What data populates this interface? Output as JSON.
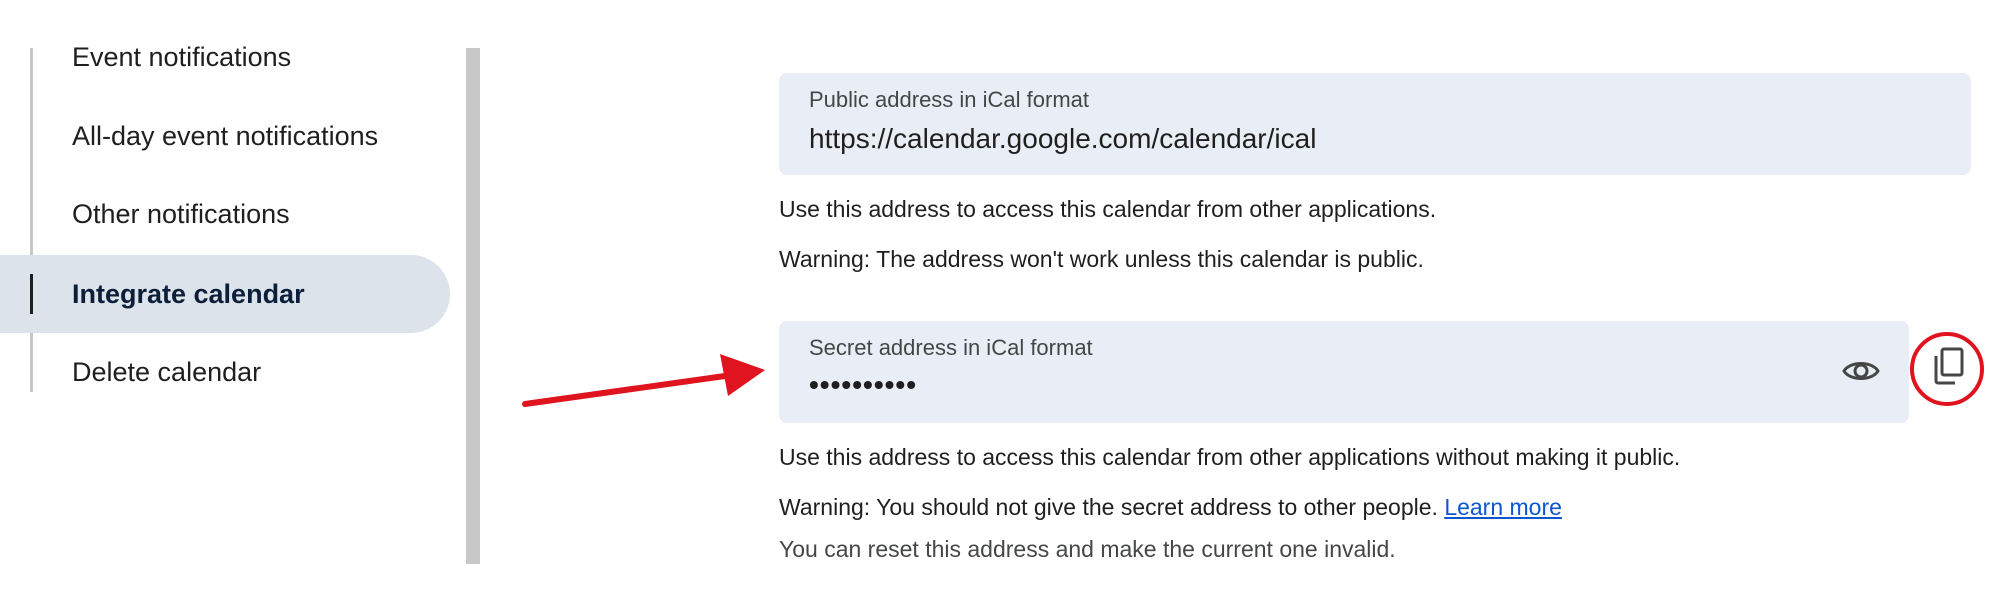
{
  "sidebar": {
    "items": [
      {
        "label": "Event notifications"
      },
      {
        "label": "All-day event notifications"
      },
      {
        "label": "Other notifications"
      },
      {
        "label": "Integrate calendar"
      },
      {
        "label": "Delete calendar"
      }
    ],
    "active_item": "Integrate calendar"
  },
  "public_address": {
    "label": "Public address in iCal format",
    "value": "https://calendar.google.com/calendar/ical",
    "help": "Use this address to access this calendar from other applications.",
    "warning": "Warning: The address won't work unless this calendar is public."
  },
  "secret_address": {
    "label": "Secret address in iCal format",
    "value": "••••••••••",
    "show_icon": "eye-icon",
    "copy_icon": "copy-icon",
    "help": "Use this address to access this calendar from other applications without making it public.",
    "warning": "Warning: You should not give the secret address to other people.",
    "learn_more": "Learn more",
    "reset_note": "You can reset this address and make the current one invalid."
  },
  "annotations": {
    "arrow_color": "#e0141e",
    "circle_color": "#e0141e"
  },
  "colors": {
    "field_bg": "#e8edf6",
    "active_bg": "#dde3ea",
    "link": "#0b57d0"
  }
}
